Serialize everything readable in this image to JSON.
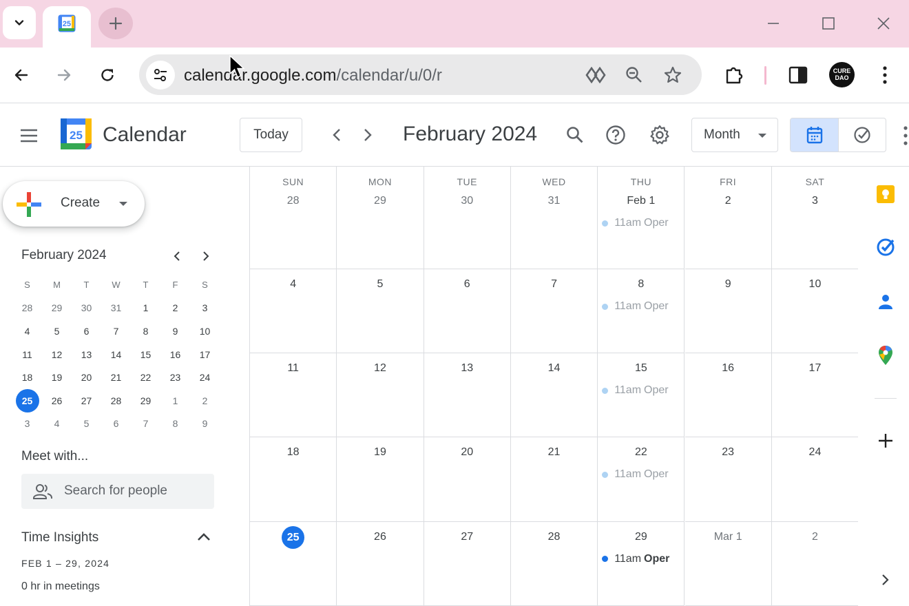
{
  "browser": {
    "tab": {
      "favicon_text": "25"
    },
    "url_host": "calendar.google.com",
    "url_path": "/calendar/u/0/r",
    "profile_text": "CURE DAO"
  },
  "header": {
    "app_name": "Calendar",
    "logo_text": "25",
    "today_label": "Today",
    "month_title": "February 2024",
    "view_label": "Month"
  },
  "sidebar": {
    "create_label": "Create",
    "mini_calendar": {
      "title": "February 2024",
      "days_of_week": [
        "S",
        "M",
        "T",
        "W",
        "T",
        "F",
        "S"
      ],
      "weeks": [
        [
          "28",
          "29",
          "30",
          "31",
          "1",
          "2",
          "3"
        ],
        [
          "4",
          "5",
          "6",
          "7",
          "8",
          "9",
          "10"
        ],
        [
          "11",
          "12",
          "13",
          "14",
          "15",
          "16",
          "17"
        ],
        [
          "18",
          "19",
          "20",
          "21",
          "22",
          "23",
          "24"
        ],
        [
          "25",
          "26",
          "27",
          "28",
          "29",
          "1",
          "2"
        ],
        [
          "3",
          "4",
          "5",
          "6",
          "7",
          "8",
          "9"
        ]
      ],
      "selected": "25"
    },
    "meet_with_title": "Meet with...",
    "search_people_placeholder": "Search for people",
    "time_insights": {
      "title": "Time Insights",
      "range": "FEB 1 – 29, 2024",
      "meetings": "0 hr in meetings"
    }
  },
  "month_view": {
    "days_of_week": [
      "SUN",
      "MON",
      "TUE",
      "WED",
      "THU",
      "FRI",
      "SAT"
    ],
    "weeks": [
      [
        {
          "label": "28",
          "muted": true
        },
        {
          "label": "29",
          "muted": true
        },
        {
          "label": "30",
          "muted": true
        },
        {
          "label": "31",
          "muted": true
        },
        {
          "label": "Feb 1",
          "event": {
            "time": "11am",
            "title": "Oper"
          }
        },
        {
          "label": "2"
        },
        {
          "label": "3"
        }
      ],
      [
        {
          "label": "4"
        },
        {
          "label": "5"
        },
        {
          "label": "6"
        },
        {
          "label": "7"
        },
        {
          "label": "8",
          "event": {
            "time": "11am",
            "title": "Oper"
          }
        },
        {
          "label": "9"
        },
        {
          "label": "10"
        }
      ],
      [
        {
          "label": "11"
        },
        {
          "label": "12"
        },
        {
          "label": "13"
        },
        {
          "label": "14"
        },
        {
          "label": "15",
          "event": {
            "time": "11am",
            "title": "Oper"
          }
        },
        {
          "label": "16"
        },
        {
          "label": "17"
        }
      ],
      [
        {
          "label": "18"
        },
        {
          "label": "19"
        },
        {
          "label": "20"
        },
        {
          "label": "21"
        },
        {
          "label": "22",
          "event": {
            "time": "11am",
            "title": "Oper"
          }
        },
        {
          "label": "23"
        },
        {
          "label": "24"
        }
      ],
      [
        {
          "label": "25",
          "today": true
        },
        {
          "label": "26"
        },
        {
          "label": "27"
        },
        {
          "label": "28"
        },
        {
          "label": "29",
          "event": {
            "time": "11am",
            "title": "Oper",
            "current": true
          }
        },
        {
          "label": "Mar 1",
          "muted": true
        },
        {
          "label": "2",
          "muted": true
        }
      ]
    ]
  },
  "side_panel": {
    "items": [
      "keep-icon",
      "tasks-icon",
      "contacts-icon",
      "maps-icon",
      "add-icon"
    ]
  },
  "colors": {
    "accent": "#1a73e8",
    "tab_strip": "#f6d6e4",
    "event_past_dot": "#aed3f3"
  }
}
